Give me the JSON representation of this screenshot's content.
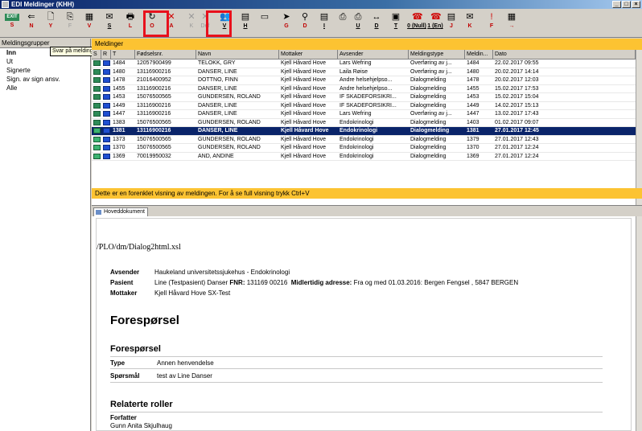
{
  "window": {
    "title": "EDI Meldinger (KHH)"
  },
  "toolbar": [
    {
      "label": "S",
      "icon": "exit-icon",
      "glyph": "EXIT"
    },
    {
      "label": "N",
      "icon": "back-arrow-icon",
      "glyph": "⇐"
    },
    {
      "label": "Y",
      "icon": "new-doc-icon",
      "glyph": "🗋"
    },
    {
      "label": "F",
      "icon": "copy-icon",
      "glyph": "⎘"
    },
    {
      "label": "V",
      "icon": "calendar-icon",
      "glyph": "▦"
    },
    {
      "label": "S",
      "icon": "reply-icon",
      "glyph": "✉"
    },
    {
      "label": "L",
      "icon": "print-preview-icon",
      "glyph": "🖶"
    },
    {
      "label": "O",
      "icon": "refresh-icon",
      "glyph": "↻"
    },
    {
      "label": "A",
      "icon": "delete-x-icon",
      "glyph": "✕"
    },
    {
      "label": "K",
      "icon": "x-gray-icon",
      "glyph": "✕"
    },
    {
      "label": "Def",
      "icon": "x-def-icon",
      "glyph": "✕"
    },
    {
      "label": "V",
      "icon": "people-icon",
      "glyph": "👥"
    },
    {
      "label": "H",
      "icon": "archive-icon",
      "glyph": "▤"
    },
    {
      "label": "",
      "icon": "window-icon",
      "glyph": "▭"
    },
    {
      "label": "G",
      "icon": "forward-icon",
      "glyph": "➤"
    },
    {
      "label": "D",
      "icon": "attach-icon",
      "glyph": "⚲"
    },
    {
      "label": "I",
      "icon": "list-icon",
      "glyph": "▤"
    },
    {
      "label": "",
      "icon": "printer-icon",
      "glyph": "⎙"
    },
    {
      "label": "U",
      "icon": "print-icon",
      "glyph": "⎙"
    },
    {
      "label": "D",
      "icon": "arrows-icon",
      "glyph": "↔"
    },
    {
      "label": "T",
      "icon": "monitor-icon",
      "glyph": "▣"
    },
    {
      "label": "0 (Null)",
      "icon": "phone-red-icon",
      "glyph": "☎"
    },
    {
      "label": "1 (En)",
      "icon": "phone-red2-icon",
      "glyph": "☎"
    },
    {
      "label": "J",
      "icon": "notes-icon",
      "glyph": "▤"
    },
    {
      "label": "K",
      "icon": "mail-icon",
      "glyph": "✉"
    },
    {
      "label": "F",
      "icon": "flag-icon",
      "glyph": "!"
    },
    {
      "label": "→",
      "icon": "grid-icon",
      "glyph": "▦"
    }
  ],
  "sidebar": {
    "title": "Meldingsgrupper",
    "tooltip": "Svar på melding",
    "items": [
      "Inn",
      "Ut",
      "Signerte",
      "Sign. av sign ansv.",
      "Alle"
    ]
  },
  "messages": {
    "title": "Meldinger",
    "columns": [
      "S",
      "R",
      "T",
      "Fødselsnr.",
      "Navn",
      "Mottaker",
      "Avsender",
      "Meldingstype",
      "Meldin...",
      "Dato"
    ],
    "rows": [
      {
        "t": "1484",
        "fnr": "12057900499",
        "navn": "TELOKK, GRY",
        "mottaker": "Kjell Håvard Hove",
        "avsender": "Lars Wefring",
        "type": "Overføring av j...",
        "nr": "1484",
        "dato": "22.02.2017 09:55"
      },
      {
        "t": "1480",
        "fnr": "13116900216",
        "navn": "DANSER, LINE",
        "mottaker": "Kjell Håvard Hove",
        "avsender": "Laila Røise",
        "type": "Overføring av j...",
        "nr": "1480",
        "dato": "20.02.2017 14:14"
      },
      {
        "t": "1478",
        "fnr": "21016400952",
        "navn": "DOTTNO, FINN",
        "mottaker": "Kjell Håvard Hove",
        "avsender": "Andre helsehjelpso...",
        "type": "Dialogmelding",
        "nr": "1478",
        "dato": "20.02.2017 12:03"
      },
      {
        "t": "1455",
        "fnr": "13116900216",
        "navn": "DANSER, LINE",
        "mottaker": "Kjell Håvard Hove",
        "avsender": "Andre helsehjelpso...",
        "type": "Dialogmelding",
        "nr": "1455",
        "dato": "15.02.2017 17:53"
      },
      {
        "t": "1453",
        "fnr": "15076500565",
        "navn": "GUNDERSEN, ROLAND",
        "mottaker": "Kjell Håvard Hove",
        "avsender": "IF SKADEFORSIKRI...",
        "type": "Dialogmelding",
        "nr": "1453",
        "dato": "15.02.2017 15:04"
      },
      {
        "t": "1449",
        "fnr": "13116900216",
        "navn": "DANSER, LINE",
        "mottaker": "Kjell Håvard Hove",
        "avsender": "IF SKADEFORSIKRI...",
        "type": "Dialogmelding",
        "nr": "1449",
        "dato": "14.02.2017 15:13"
      },
      {
        "t": "1447",
        "fnr": "13116900216",
        "navn": "DANSER, LINE",
        "mottaker": "Kjell Håvard Hove",
        "avsender": "Lars Wefring",
        "type": "Overføring av j...",
        "nr": "1447",
        "dato": "13.02.2017 17:43"
      },
      {
        "t": "1383",
        "fnr": "15076500565",
        "navn": "GUNDERSEN, ROLAND",
        "mottaker": "Kjell Håvard Hove",
        "avsender": "Endokrinologi",
        "type": "Dialogmelding",
        "nr": "1403",
        "dato": "01.02.2017 09:07"
      },
      {
        "t": "1381",
        "fnr": "13116900216",
        "navn": "DANSER, LINE",
        "mottaker": "Kjell Håvard Hove",
        "avsender": "Endokrinologi",
        "type": "Dialogmelding",
        "nr": "1381",
        "dato": "27.01.2017 12:45",
        "selected": true
      },
      {
        "t": "1373",
        "fnr": "15076500565",
        "navn": "GUNDERSEN, ROLAND",
        "mottaker": "Kjell Håvard Hove",
        "avsender": "Endokrinologi",
        "type": "Dialogmelding",
        "nr": "1379",
        "dato": "27.01.2017 12:43"
      },
      {
        "t": "1370",
        "fnr": "15076500565",
        "navn": "GUNDERSEN, ROLAND",
        "mottaker": "Kjell Håvard Hove",
        "avsender": "Endokrinologi",
        "type": "Dialogmelding",
        "nr": "1370",
        "dato": "27.01.2017 12:24"
      },
      {
        "t": "1369",
        "fnr": "70019950032",
        "navn": "AND, ANDINE",
        "mottaker": "Kjell Håvard Hove",
        "avsender": "Endokrinologi",
        "type": "Dialogmelding",
        "nr": "1369",
        "dato": "27.01.2017 12:24"
      }
    ]
  },
  "notice": "Dette er en forenklet visning av meldingen. For å se full visning trykk Ctrl+V",
  "doc_tab": "Hoveddokument",
  "document": {
    "path": "/PLO/dm/Dialog2html.xsl",
    "avsender_label": "Avsender",
    "avsender": "Haukeland universitetssjukehus - Endokrinologi",
    "pasient_label": "Pasient",
    "pasient": "Line (Testpasient) Danser",
    "fnr_label": "FNR:",
    "fnr": "131169 00216",
    "adresse_label": "Midlertidig adresse:",
    "adresse": "Fra og med 01.03.2016: Bergen Fengsel , 5847  BERGEN",
    "mottaker_label": "Mottaker",
    "mottaker": "Kjell Håvard  Hove  SX-Test",
    "heading": "Forespørsel",
    "section1": "Forespørsel",
    "type_label": "Type",
    "type_value": "Annen henvendelse",
    "sporsmal_label": "Spørsmål",
    "sporsmal_value": "test av Line Danser",
    "section2": "Relaterte roller",
    "forfatter_label": "Forfatter",
    "forfatter": "Gunn Anita  Skjulhaug"
  }
}
